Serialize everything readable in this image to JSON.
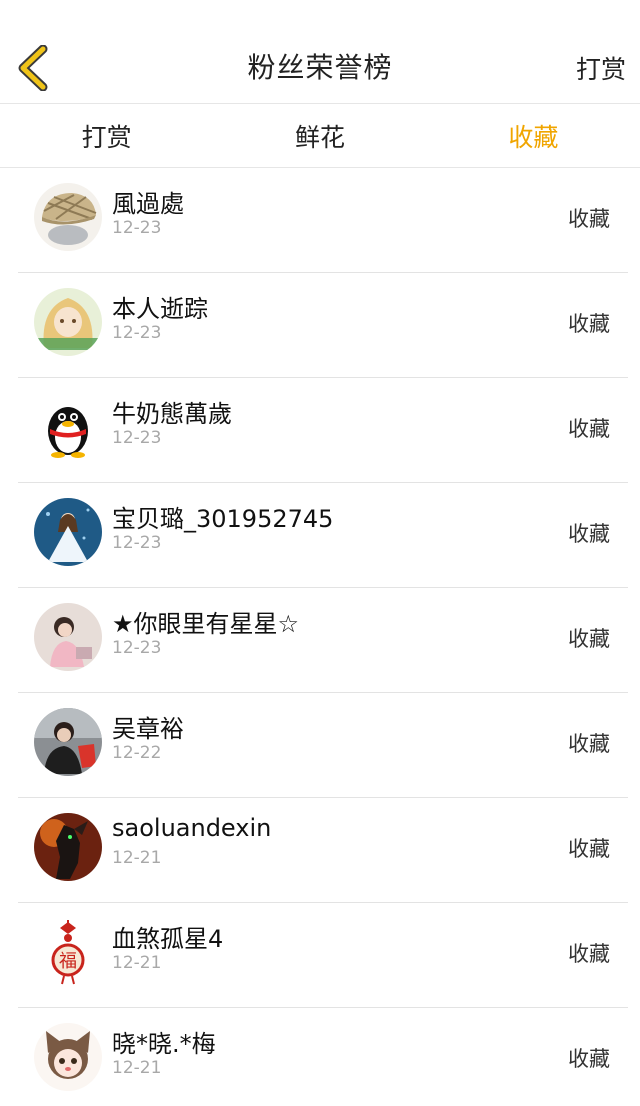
{
  "header": {
    "title": "粉丝荣誉榜",
    "right_action": "打赏",
    "back_icon": "chevron-left-icon",
    "back_color": "#f0c419"
  },
  "tabs": [
    {
      "label": "打赏",
      "active": false
    },
    {
      "label": "鲜花",
      "active": false
    },
    {
      "label": "收藏",
      "active": true
    }
  ],
  "accent_color": "#f0a500",
  "list": [
    {
      "name": "風過處",
      "date": "12-23",
      "action": "收藏",
      "avatar": "plaid-cap-avatar"
    },
    {
      "name": "本人逝踪",
      "date": "12-23",
      "action": "收藏",
      "avatar": "anime-girl-avatar"
    },
    {
      "name": "牛奶態萬歲",
      "date": "12-23",
      "action": "收藏",
      "avatar": "qq-penguin-avatar"
    },
    {
      "name": "宝贝璐_301952745",
      "date": "12-23",
      "action": "收藏",
      "avatar": "bride-avatar"
    },
    {
      "name": "★你眼里有星星☆",
      "date": "12-23",
      "action": "收藏",
      "avatar": "girl-photo-avatar"
    },
    {
      "name": "吴章裕",
      "date": "12-22",
      "action": "收藏",
      "avatar": "woman-photo-avatar"
    },
    {
      "name": "saoluandexin",
      "date": "12-21",
      "action": "收藏",
      "avatar": "warrior-avatar"
    },
    {
      "name": "血煞孤星4",
      "date": "12-21",
      "action": "收藏",
      "avatar": "fu-knot-avatar"
    },
    {
      "name": "晓*晓.*梅",
      "date": "12-21",
      "action": "收藏",
      "avatar": "cat-girl-avatar"
    }
  ]
}
